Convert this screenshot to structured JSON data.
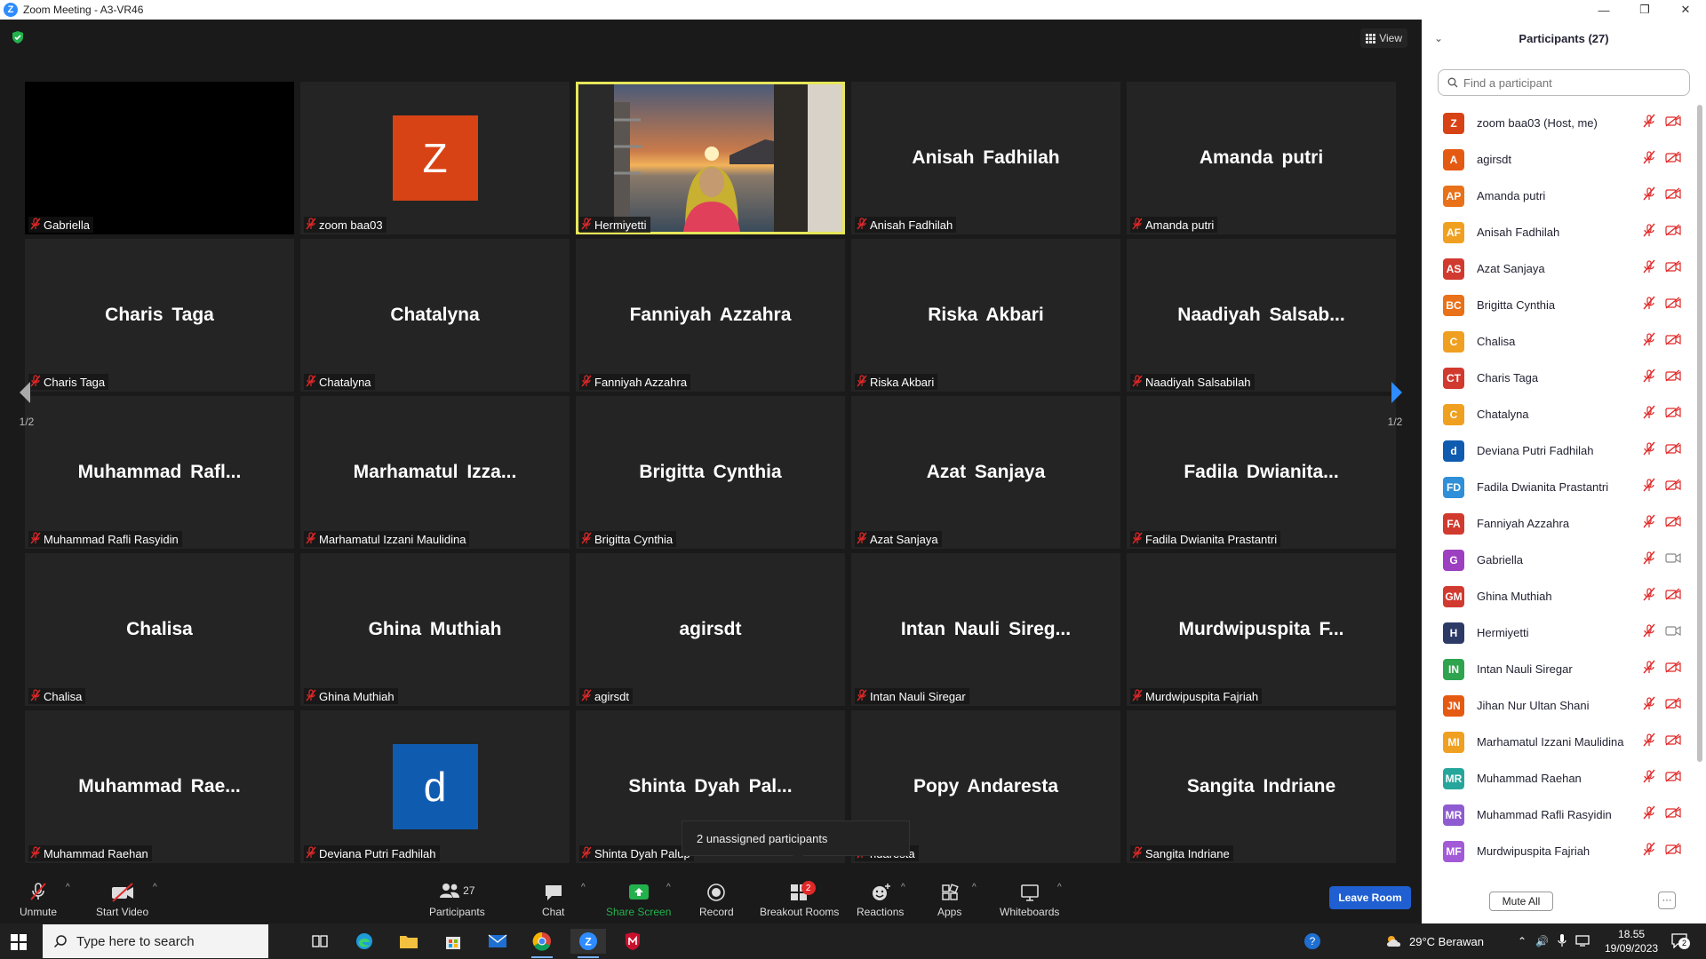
{
  "window": {
    "title": "Zoom Meeting - A3-VR46",
    "controls": [
      "—",
      "❐",
      "✕"
    ]
  },
  "view_label": "View",
  "tiles": [
    {
      "display": "",
      "label": "Gabriella",
      "kind": "black"
    },
    {
      "display": "Z",
      "label": "zoom baa03",
      "kind": "avatar",
      "color": "#d84315"
    },
    {
      "display": "",
      "label": "Hermiyetti",
      "kind": "video"
    },
    {
      "display": "Anisah Fadhilah",
      "label": "Anisah Fadhilah",
      "kind": "name"
    },
    {
      "display": "Amanda putri",
      "label": "Amanda putri",
      "kind": "name"
    },
    {
      "display": "Charis Taga",
      "label": "Charis Taga",
      "kind": "name"
    },
    {
      "display": "Chatalyna",
      "label": "Chatalyna",
      "kind": "name"
    },
    {
      "display": "Fanniyah Azzahra",
      "label": "Fanniyah Azzahra",
      "kind": "name"
    },
    {
      "display": "Riska Akbari",
      "label": "Riska Akbari",
      "kind": "name"
    },
    {
      "display": "Naadiyah Salsab...",
      "label": "Naadiyah Salsabilah",
      "kind": "name"
    },
    {
      "display": "Muhammad Rafl...",
      "label": "Muhammad Rafli Rasyidin",
      "kind": "name"
    },
    {
      "display": "Marhamatul Izza...",
      "label": "Marhamatul Izzani Maulidina",
      "kind": "name"
    },
    {
      "display": "Brigitta Cynthia",
      "label": "Brigitta Cynthia",
      "kind": "name"
    },
    {
      "display": "Azat Sanjaya",
      "label": "Azat Sanjaya",
      "kind": "name"
    },
    {
      "display": "Fadila Dwianita...",
      "label": "Fadila Dwianita Prastantri",
      "kind": "name"
    },
    {
      "display": "Chalisa",
      "label": "Chalisa",
      "kind": "name"
    },
    {
      "display": "Ghina Muthiah",
      "label": "Ghina Muthiah",
      "kind": "name"
    },
    {
      "display": "agirsdt",
      "label": "agirsdt",
      "kind": "name"
    },
    {
      "display": "Intan Nauli Sireg...",
      "label": "Intan Nauli Siregar",
      "kind": "name"
    },
    {
      "display": "Murdwipuspita F...",
      "label": "Murdwipuspita Fajriah",
      "kind": "name"
    },
    {
      "display": "Muhammad Rae...",
      "label": "Muhammad Raehan",
      "kind": "name"
    },
    {
      "display": "d",
      "label": "Deviana Putri Fadhilah",
      "kind": "avatar",
      "color": "#0f5bb0"
    },
    {
      "display": "Shinta Dyah Pal...",
      "label": "Shinta Dyah Palup",
      "kind": "name"
    },
    {
      "display": "Popy Andaresta",
      "label": "ndaresta",
      "kind": "name"
    },
    {
      "display": "Sangita Indriane",
      "label": "Sangita Indriane",
      "kind": "name"
    }
  ],
  "pager": {
    "left": "1/2",
    "right": "1/2"
  },
  "tooltip": "2 unassigned participants",
  "toolbar": {
    "unmute": "Unmute",
    "start_video": "Start Video",
    "participants": "Participants",
    "participants_count": "27",
    "chat": "Chat",
    "share_screen": "Share Screen",
    "record": "Record",
    "breakout_rooms": "Breakout Rooms",
    "breakout_badge": "2",
    "reactions": "Reactions",
    "apps": "Apps",
    "whiteboards": "Whiteboards",
    "leave": "Leave Room"
  },
  "panel": {
    "title": "Participants (27)",
    "search_placeholder": "Find a participant",
    "mute_all": "Mute All",
    "more": "···",
    "participants": [
      {
        "initials": "Z",
        "name": "zoom baa03 (Host, me)",
        "color": "#d84315",
        "video": "off"
      },
      {
        "initials": "A",
        "name": "agirsdt",
        "color": "#e55a12",
        "video": "off"
      },
      {
        "initials": "AP",
        "name": "Amanda putri",
        "color": "#e8711a",
        "video": "off"
      },
      {
        "initials": "AF",
        "name": "Anisah Fadhilah",
        "color": "#f0a020",
        "video": "off"
      },
      {
        "initials": "AS",
        "name": "Azat Sanjaya",
        "color": "#d13a2f",
        "video": "off"
      },
      {
        "initials": "BC",
        "name": "Brigitta Cynthia",
        "color": "#e8711a",
        "video": "off"
      },
      {
        "initials": "C",
        "name": "Chalisa",
        "color": "#f0a020",
        "video": "off"
      },
      {
        "initials": "CT",
        "name": "Charis Taga",
        "color": "#d13a2f",
        "video": "off"
      },
      {
        "initials": "C",
        "name": "Chatalyna",
        "color": "#f0a020",
        "video": "off"
      },
      {
        "initials": "d",
        "name": "Deviana Putri Fadhilah",
        "color": "#0f5bb0",
        "video": "off"
      },
      {
        "initials": "FD",
        "name": "Fadila Dwianita Prastantri",
        "color": "#2f8fd8",
        "video": "off"
      },
      {
        "initials": "FA",
        "name": "Fanniyah Azzahra",
        "color": "#d13a2f",
        "video": "off"
      },
      {
        "initials": "G",
        "name": "Gabriella",
        "color": "#9c3fc0",
        "video": "on"
      },
      {
        "initials": "GM",
        "name": "Ghina Muthiah",
        "color": "#d13a2f",
        "video": "off"
      },
      {
        "initials": "H",
        "name": "Hermiyetti",
        "color": "#2d3a66",
        "video": "on"
      },
      {
        "initials": "IN",
        "name": "Intan Nauli Siregar",
        "color": "#2ea44f",
        "video": "off"
      },
      {
        "initials": "JN",
        "name": "Jihan Nur Ultan Shani",
        "color": "#e55a12",
        "video": "off"
      },
      {
        "initials": "MI",
        "name": "Marhamatul Izzani Maulidina",
        "color": "#f0a020",
        "video": "off"
      },
      {
        "initials": "MR",
        "name": "Muhammad Raehan",
        "color": "#26a69a",
        "video": "off"
      },
      {
        "initials": "MR",
        "name": "Muhammad Rafli Rasyidin",
        "color": "#8e5bd0",
        "video": "off"
      },
      {
        "initials": "MF",
        "name": "Murdwipuspita Fajriah",
        "color": "#a25ad6",
        "video": "off"
      }
    ]
  },
  "taskbar": {
    "search_placeholder": "Type here to search",
    "weather": "29°C Berawan",
    "time": "18.55",
    "date": "19/09/2023",
    "notification_count": "2"
  },
  "colors": {
    "accent": "#2d8cff",
    "share_green": "#23b14d",
    "leave_blue": "#1f5fd1",
    "mute_red": "#e02828",
    "active_border": "#e6e65a"
  }
}
